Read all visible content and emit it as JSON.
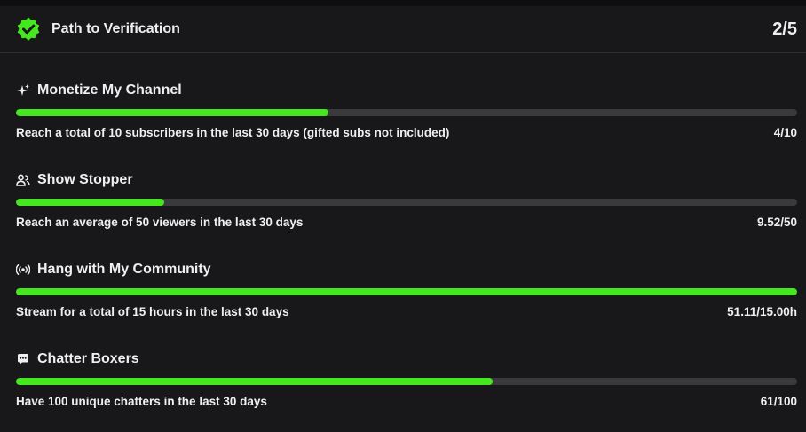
{
  "header": {
    "title": "Path to Verification",
    "count": "2/5",
    "icon": "verified-badge-icon",
    "accent": "#45e81e"
  },
  "sections": [
    {
      "icon": "sparkle-icon",
      "title": "Monetize My Channel",
      "description": "Reach a total of 10 subscribers in the last 30 days (gifted subs not included)",
      "value": "4/10",
      "progress": 0.4
    },
    {
      "icon": "viewers-icon",
      "title": "Show Stopper",
      "description": "Reach an average of 50 viewers in the last 30 days",
      "value": "9.52/50",
      "progress": 0.19
    },
    {
      "icon": "broadcast-icon",
      "title": "Hang with My Community",
      "description": "Stream for a total of 15 hours in the last 30 days",
      "value": "51.11/15.00h",
      "progress": 1.0
    },
    {
      "icon": "chat-bubble-icon",
      "title": "Chatter Boxers",
      "description": "Have 100 unique chatters in the last 30 days",
      "value": "61/100",
      "progress": 0.61
    }
  ]
}
